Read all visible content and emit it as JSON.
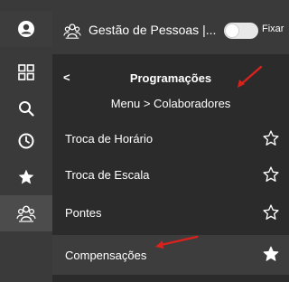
{
  "rail": {
    "items": [
      {
        "icon": "user-icon"
      },
      {
        "icon": "grid-icon"
      },
      {
        "icon": "search-icon"
      },
      {
        "icon": "clock-icon"
      },
      {
        "icon": "star-icon"
      },
      {
        "icon": "people-icon"
      }
    ]
  },
  "topbar": {
    "brand": "Gestão de Pessoas |...",
    "toggle_label": "Fixar"
  },
  "header": {
    "back": "<",
    "title": "Programações",
    "breadcrumb": "Menu  > Colaboradores"
  },
  "menu": {
    "items": [
      {
        "label": "Troca de Horário",
        "favorite": false
      },
      {
        "label": "Troca de Escala",
        "favorite": false
      },
      {
        "label": "Pontes",
        "favorite": false
      },
      {
        "label": "Compensações",
        "favorite": true
      }
    ]
  },
  "colors": {
    "rail_bg": "#3a3a3a",
    "panel_bg": "#2b2b2b",
    "annotation_arrow": "#d9221c"
  }
}
